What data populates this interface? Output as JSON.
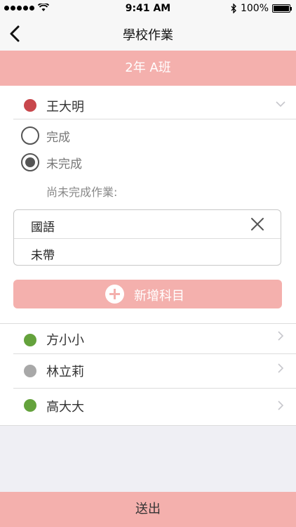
{
  "status_bar": {
    "time": "9:41 AM",
    "battery": "100%",
    "battery_level": 1.0
  },
  "nav": {
    "title": "學校作業"
  },
  "class_header": {
    "label": "2年 A班"
  },
  "expanded_student": {
    "name": "王大明",
    "dot_color": "#c8474c",
    "options": [
      {
        "label": "完成",
        "checked": false
      },
      {
        "label": "未完成",
        "checked": true
      }
    ],
    "pending_label": "尚未完成作業:",
    "subjects": [
      "國語",
      "未帶"
    ],
    "add_label": "新增科目"
  },
  "students": [
    {
      "name": "方小小",
      "dot_color": "#64a23c"
    },
    {
      "name": "林立莉",
      "dot_color": "#a8a8a8"
    },
    {
      "name": "高大大",
      "dot_color": "#64a23c"
    }
  ],
  "submit_label": "送出",
  "colors": {
    "accent": "#f4b0ad",
    "background": "#efeff4"
  }
}
